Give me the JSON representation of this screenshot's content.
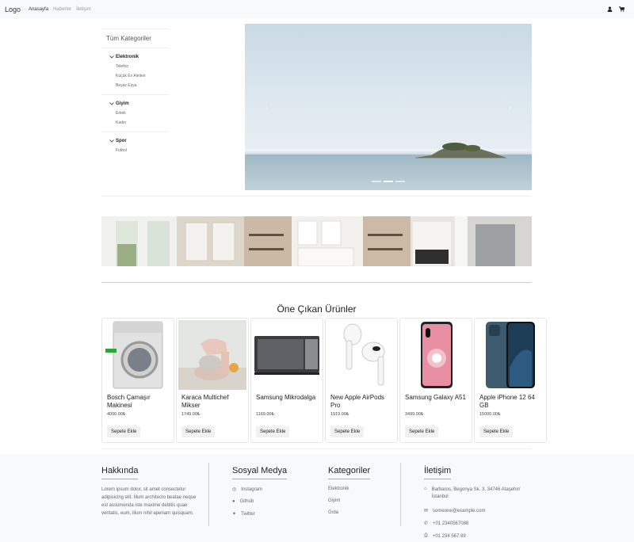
{
  "nav": {
    "logo": "Logo",
    "links": [
      "Anasayfa",
      "Haberler",
      "İletişim"
    ]
  },
  "sidebar": {
    "title": "Tüm Kategoriler",
    "categories": [
      {
        "name": "Elektronik",
        "items": [
          "Telefon",
          "Küçük Ev Aletleri",
          "Beyaz Eşya"
        ]
      },
      {
        "name": "Giyim",
        "items": [
          "Erkek",
          "Kadın"
        ]
      },
      {
        "name": "Spor",
        "items": [
          "Futbol"
        ]
      }
    ]
  },
  "featured": {
    "title": "Öne Çıkan Ürünler",
    "button_label": "Sepete Ekle",
    "products": [
      {
        "name": "Bosch Çamaşır Makinesi",
        "price": "4000.00₺"
      },
      {
        "name": "Karaca Multichef Mikser",
        "price": "1749.00₺"
      },
      {
        "name": "Samsung Mikrodalga",
        "price": "1169.00₺"
      },
      {
        "name": "New Apple AirPods Pro",
        "price": "1919.00₺"
      },
      {
        "name": "Samsung Galaxy A51",
        "price": "3499.00₺"
      },
      {
        "name": "Apple iPhone 12 64 GB",
        "price": "15000.00₺"
      }
    ]
  },
  "footer": {
    "about": {
      "title": "Hakkında",
      "text": "Lorem ipsum dolor, sit amet consectetur adipisicing elit. Illum architecto beatae neque est assumenda iste maxime debitis quae veritatis, eum, illum nihil aperiam quisquam."
    },
    "social": {
      "title": "Sosyal Medya",
      "links": [
        "Instagram",
        "Github",
        "Twitter"
      ]
    },
    "categories": {
      "title": "Kategoriler",
      "links": [
        "Elektronik",
        "Giyim",
        "Gıda"
      ]
    },
    "contact": {
      "title": "İletişim",
      "address": "Barbaros, Begonya Sk. 3, 34746 Ataşehir/İstanbul",
      "email": "someone@example.com",
      "phone": "+01 2340567088",
      "fax": "+01 234 567 89"
    }
  }
}
